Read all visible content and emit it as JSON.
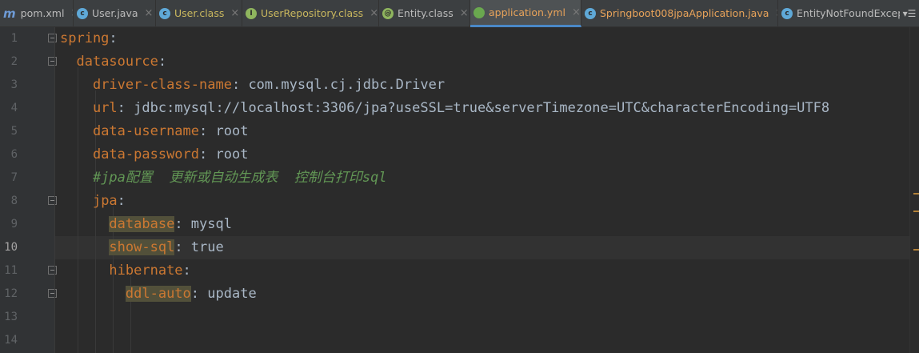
{
  "tabs": [
    {
      "label": "pom.xml",
      "icon": "maven-icon",
      "icon_text": "m",
      "color": "#6e9bd6",
      "active": false
    },
    {
      "label": "User.java",
      "icon": "class-icon",
      "icon_text": "c",
      "color": "#5fa9d8",
      "active": false
    },
    {
      "label": "User.class",
      "icon": "class-icon",
      "icon_text": "c",
      "color": "#5fa9d8",
      "active": false
    },
    {
      "label": "UserRepository.class",
      "icon": "interface-icon",
      "icon_text": "I",
      "color": "#8fb55e",
      "active": false
    },
    {
      "label": "Entity.class",
      "icon": "annotation-icon",
      "icon_text": "@",
      "color": "#8fb55e",
      "active": false
    },
    {
      "label": "application.yml",
      "icon": "spring-yml-icon",
      "icon_text": "●",
      "color": "#6aa84f",
      "active": true
    },
    {
      "label": "Springboot008jpaApplication.java",
      "icon": "spring-class-icon",
      "icon_text": "c",
      "color": "#5fa9d8",
      "active": false
    },
    {
      "label": "EntityNotFoundExcep",
      "icon": "exception-class-icon",
      "icon_text": "c",
      "color": "#5fa9d8",
      "active": false
    }
  ],
  "tab_close_glyph": "×",
  "tab_overflow_glyph": "▾☰",
  "line_numbers": [
    "1",
    "2",
    "3",
    "4",
    "5",
    "6",
    "7",
    "8",
    "9",
    "10",
    "11",
    "12",
    "13",
    "14"
  ],
  "current_line": "10",
  "code": {
    "l1_key": "spring",
    "l1_colon": ":",
    "l2_key": "datasource",
    "l2_colon": ":",
    "l3_key": "driver-class-name",
    "l3_sep": ": ",
    "l3_val": "com.mysql.cj.jdbc.Driver",
    "l4_key": "url",
    "l4_sep": ": ",
    "l4_val": "jdbc:mysql://localhost:3306/jpa?useSSL=true&serverTimezone=UTC&characterEncoding=UTF8",
    "l5_key": "data-username",
    "l5_sep": ": ",
    "l5_val": "root",
    "l6_key": "data-password",
    "l6_sep": ": ",
    "l6_val": "root",
    "l7_comment": "#jpa配置  更新或自动生成表  控制台打印sql",
    "l8_key": "jpa",
    "l8_colon": ":",
    "l9_key": "database",
    "l9_sep": ": ",
    "l9_val": "mysql",
    "l10_key": "show-sql",
    "l10_sep": ": ",
    "l10_val": "true",
    "l11_key": "hibernate",
    "l11_colon": ":",
    "l12_key": "ddl-auto",
    "l12_sep": ": ",
    "l12_val": "update"
  },
  "colors": {
    "background": "#2b2b2b",
    "gutter": "#313335",
    "key": "#cc7832",
    "value": "#a9b7c6",
    "comment": "#629755",
    "key_highlight": "#52503a",
    "active_tab_underline": "#4a88c7"
  }
}
